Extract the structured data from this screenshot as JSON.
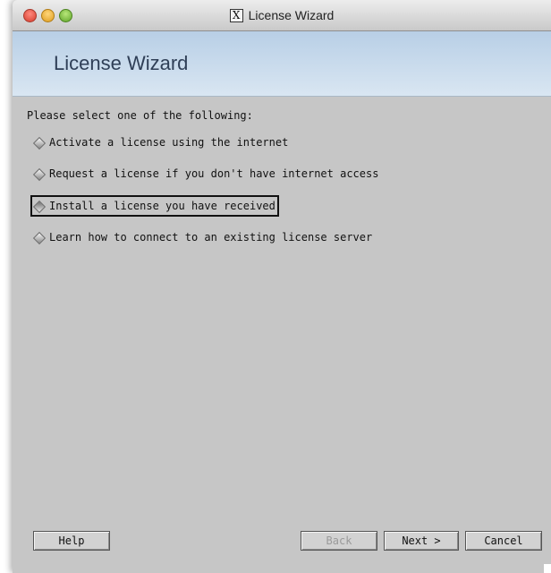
{
  "window": {
    "title": "License Wizard"
  },
  "banner": {
    "title": "License Wizard"
  },
  "prompt": "Please select one of the following:",
  "options": [
    {
      "label": "Activate a license using the internet",
      "selected": false
    },
    {
      "label": "Request a license if you don't have internet access",
      "selected": false
    },
    {
      "label": "Install a license you have received",
      "selected": true
    },
    {
      "label": "Learn how to connect to an existing license server",
      "selected": false
    }
  ],
  "buttons": {
    "help": "Help",
    "back": "Back",
    "next": "Next >",
    "cancel": "Cancel"
  },
  "colors": {
    "window_bg": "#c6c6c6",
    "banner_bg": "#c9dbec",
    "banner_text": "#2f3f57"
  }
}
